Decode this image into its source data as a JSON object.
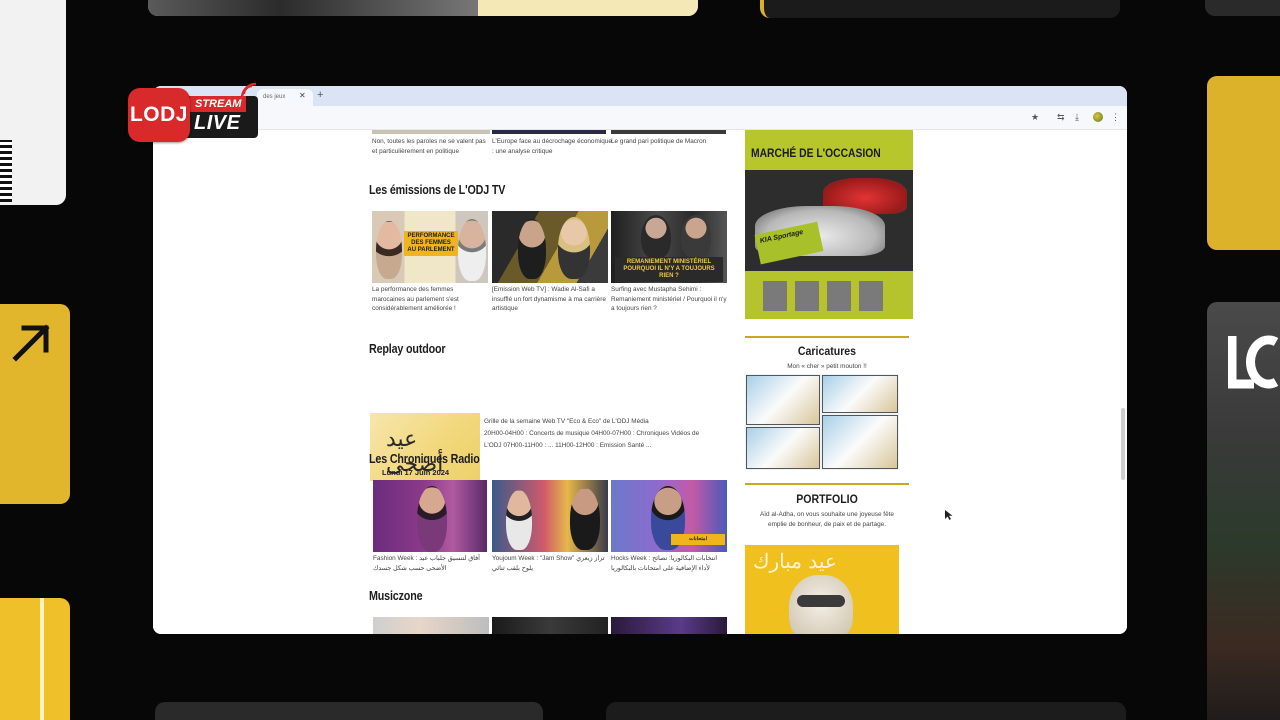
{
  "badge": {
    "brand": "LODJ",
    "stream": "STREAM",
    "live": "LIVE"
  },
  "browser": {
    "tab_title": "des jeux"
  },
  "top_captions": [
    "Non, toutes les paroles ne se valent pas et particulièrement en politique",
    "L'Europe face au décrochage économique : une analyse critique",
    "Le grand pari politique de Macron"
  ],
  "sections": {
    "odj_tv": {
      "title": "Les émissions de L'ODJ TV",
      "items": [
        {
          "caption": "La performance des femmes marocaines au parlement s'est considérablement améliorée !",
          "thumb_label": "PERFORMANCE DES FEMMES AU PARLEMENT"
        },
        {
          "caption": "[Emission Web TV] : Wadie Al-Safi a insufflé un fort dynamisme à ma carrière artistique",
          "thumb_label": ""
        },
        {
          "caption": "Surfing avec Mustapha Sehimi : Remaniement ministériel / Pourquoi il n'y a toujours rien ?",
          "thumb_label": "REMANIEMENT MINISTÉRIEL POURQUOI IL N'Y A TOUJOURS RIEN ?"
        }
      ]
    },
    "replay": {
      "title": "Replay outdoor",
      "thumb_date": "Lundi 17 Juin 2024",
      "lines": [
        "Grille de la semaine Web TV \"Eco & Eco\" de L'ODJ Média",
        "20H00-04H00 : Concerts de musique 04H00-07H00 : Chroniques Vidéos de",
        "L'ODJ 07H00-11H00 : ... 11H00-12H00 : Emission Santé ..."
      ]
    },
    "radio": {
      "title": "Les Chroniques Radio",
      "items": [
        {
          "caption": "Fashion Week : آفاق لتنسيق جلباب عيد الأضحى حسب شكل جسدك"
        },
        {
          "caption": "Youjoum Week : \"Jam Show\" تراز زيعري يلوح بلقب ثنائي"
        },
        {
          "caption": "Hocks Week : انتخابات البكالوريا: نصائح لأداء الإضافية على امتحانات بالبكالوريا"
        }
      ]
    },
    "music": {
      "title": "Musiczone"
    }
  },
  "sidebar": {
    "ad": {
      "title": "MARCHÉ DE L'OCCASION",
      "tag": "KIA Sportage"
    },
    "caricatures": {
      "title": "Caricatures",
      "subtitle": "Mon « cher » petit mouton !!"
    },
    "portfolio": {
      "title": "PORTFOLIO",
      "text": "Aïd al-Adha, on vous souhaite une joyeuse fête emplie de bonheur, de paix et de partage."
    }
  },
  "colors": {
    "accent_yellow": "#e1b52c",
    "brand_red": "#d82a2a",
    "rule_gold": "#c9a924"
  },
  "icons": [
    "star-icon",
    "download-icon",
    "menu-dots-icon",
    "chat-icon",
    "arrow-ne-icon",
    "close-icon",
    "plus-icon"
  ]
}
